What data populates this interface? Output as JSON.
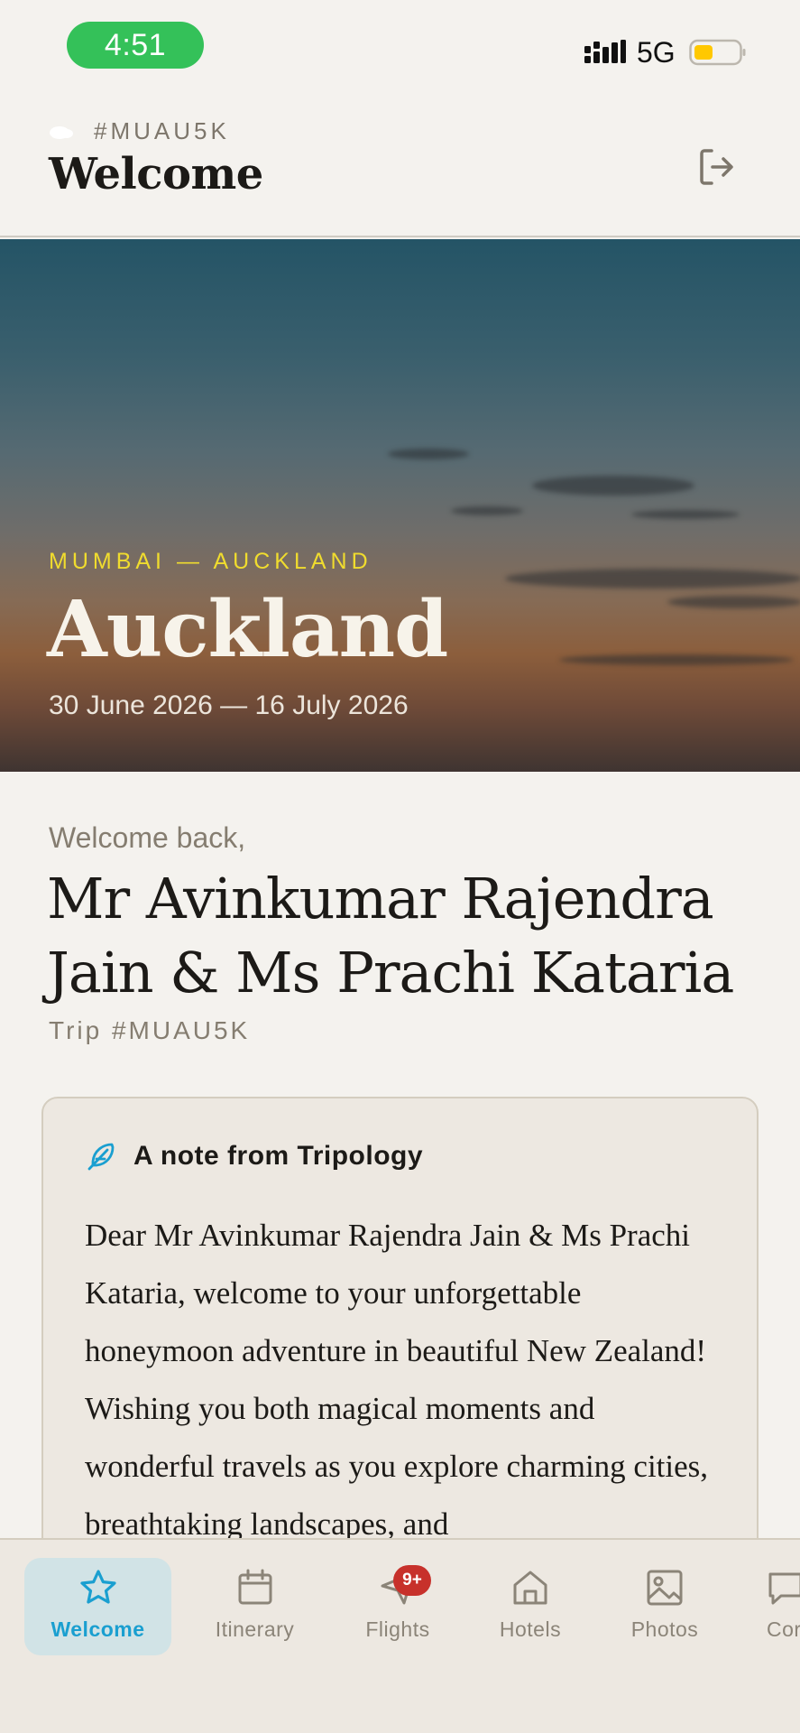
{
  "status_bar": {
    "time": "4:51",
    "network": "5G",
    "colors": {
      "time_pill": "#34c159",
      "battery_fill": "#ffc800"
    }
  },
  "header": {
    "trip_code": "#MUAU5K",
    "title": "Welcome",
    "icons": {
      "brand": "cloud-icon",
      "logout": "logout-icon"
    }
  },
  "hero": {
    "route": "MUMBAI — AUCKLAND",
    "city": "Auckland",
    "dates": "30 June 2026 — 16 July 2026"
  },
  "welcome": {
    "greeting": "Welcome back,",
    "guest_line1": "Mr Avinkumar Rajendra",
    "guest_line2": "Jain & Ms Prachi Kataria",
    "trip_ref": "Trip #MUAU5K"
  },
  "note": {
    "title": "A note from Tripology",
    "icon": "feather-icon",
    "body": "Dear Mr Avinkumar Rajendra Jain & Ms Prachi Kataria, welcome to your unforgettable honeymoon adventure in beautiful New Zealand! Wishing you both magical moments and wonderful travels as you explore charming cities, breathtaking landscapes, and"
  },
  "bottom_nav": {
    "items": [
      {
        "label": "Welcome",
        "icon": "star-icon",
        "active": true
      },
      {
        "label": "Itinerary",
        "icon": "calendar-icon",
        "active": false
      },
      {
        "label": "Flights",
        "icon": "plane-icon",
        "active": false,
        "badge": "9+"
      },
      {
        "label": "Hotels",
        "icon": "home-icon",
        "active": false
      },
      {
        "label": "Photos",
        "icon": "image-icon",
        "active": false
      },
      {
        "label": "Cor",
        "icon": "chat-icon",
        "active": false
      }
    ],
    "colors": {
      "active_bg": "#d1e3e6",
      "active_text": "#1a9fd0",
      "badge": "#c7312b"
    }
  },
  "theme": {
    "accent": "#1a9fd0",
    "route_text": "#f0dc2e",
    "background": "#f4f2ee"
  }
}
